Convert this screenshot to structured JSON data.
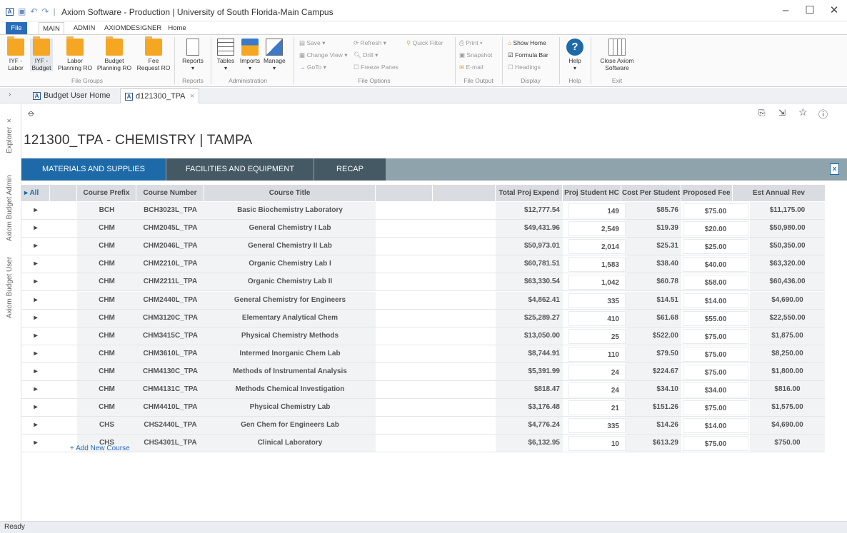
{
  "window": {
    "title": "Axiom Software - Production | University of South Florida-Main Campus",
    "minimize": "–",
    "maximize": "☐",
    "close": "✕"
  },
  "ribbon_tabs": [
    "File",
    "MAIN",
    "ADMIN",
    "AXIOMDESIGNER",
    "Home"
  ],
  "ribbon": {
    "file_groups": {
      "label": "File Groups",
      "buttons": [
        "IYF -\nLabor",
        "IYF -\nBudget",
        "Labor\nPlanning RO",
        "Budget\nPlanning RO",
        "Fee\nRequest RO"
      ]
    },
    "reports": {
      "label": "Reports",
      "button": "Reports"
    },
    "administration": {
      "label": "Administration",
      "buttons": [
        "Tables",
        "Imports",
        "Manage"
      ]
    },
    "file_options": {
      "label": "File Options",
      "save": "Save",
      "refresh": "Refresh",
      "quick_filter": "Quick Filter",
      "change_view": "Change View",
      "drill": "Drill",
      "goto": "GoTo",
      "freeze_panes": "Freeze Panes"
    },
    "file_output": {
      "label": "File Output",
      "print": "Print",
      "snapshot": "Snapshot",
      "email": "E-mail"
    },
    "display": {
      "label": "Display",
      "show_home": "Show Home",
      "formula_bar": "Formula Bar",
      "headings": "Headings"
    },
    "help": {
      "label": "Help",
      "button": "Help"
    },
    "exit": {
      "label": "Exit",
      "button": "Close Axiom\nSoftware"
    }
  },
  "doc_tabs": [
    {
      "label": "Budget User Home"
    },
    {
      "label": "d121300_TPA",
      "close": "×"
    }
  ],
  "side_tabs": [
    "Explorer",
    "Axiom Budget Admin",
    "Axiom Budget User"
  ],
  "page": {
    "title": "121300_TPA - CHEMISTRY | TAMPA"
  },
  "tabs": [
    "MATERIALS AND SUPPLIES",
    "FACILITIES AND EQUIPMENT",
    "RECAP"
  ],
  "table": {
    "all_label": "All",
    "headers": [
      "Course Prefix",
      "Course Number",
      "Course Title",
      "Total Proj Expend",
      "Proj Student HC",
      "Cost Per Student",
      "Proposed Fee",
      "Est Annual Rev"
    ],
    "rows": [
      {
        "prefix": "BCH",
        "number": "BCH3023L_TPA",
        "title": "Basic Biochemistry Laboratory",
        "expend": "$12,777.54",
        "hc": "149",
        "cps": "$85.76",
        "fee": "$75.00",
        "rev": "$11,175.00"
      },
      {
        "prefix": "CHM",
        "number": "CHM2045L_TPA",
        "title": "General Chemistry I Lab",
        "expend": "$49,431.96",
        "hc": "2,549",
        "cps": "$19.39",
        "fee": "$20.00",
        "rev": "$50,980.00"
      },
      {
        "prefix": "CHM",
        "number": "CHM2046L_TPA",
        "title": "General Chemistry II Lab",
        "expend": "$50,973.01",
        "hc": "2,014",
        "cps": "$25.31",
        "fee": "$25.00",
        "rev": "$50,350.00"
      },
      {
        "prefix": "CHM",
        "number": "CHM2210L_TPA",
        "title": "Organic Chemistry Lab I",
        "expend": "$60,781.51",
        "hc": "1,583",
        "cps": "$38.40",
        "fee": "$40.00",
        "rev": "$63,320.00"
      },
      {
        "prefix": "CHM",
        "number": "CHM2211L_TPA",
        "title": "Organic Chemistry Lab II",
        "expend": "$63,330.54",
        "hc": "1,042",
        "cps": "$60.78",
        "fee": "$58.00",
        "rev": "$60,436.00"
      },
      {
        "prefix": "CHM",
        "number": "CHM2440L_TPA",
        "title": "General Chemistry for Engineers",
        "expend": "$4,862.41",
        "hc": "335",
        "cps": "$14.51",
        "fee": "$14.00",
        "rev": "$4,690.00"
      },
      {
        "prefix": "CHM",
        "number": "CHM3120C_TPA",
        "title": "Elementary Analytical Chem",
        "expend": "$25,289.27",
        "hc": "410",
        "cps": "$61.68",
        "fee": "$55.00",
        "rev": "$22,550.00"
      },
      {
        "prefix": "CHM",
        "number": "CHM3415C_TPA",
        "title": "Physical Chemistry Methods",
        "expend": "$13,050.00",
        "hc": "25",
        "cps": "$522.00",
        "fee": "$75.00",
        "rev": "$1,875.00"
      },
      {
        "prefix": "CHM",
        "number": "CHM3610L_TPA",
        "title": "Intermed Inorganic Chem Lab",
        "expend": "$8,744.91",
        "hc": "110",
        "cps": "$79.50",
        "fee": "$75.00",
        "rev": "$8,250.00"
      },
      {
        "prefix": "CHM",
        "number": "CHM4130C_TPA",
        "title": "Methods of Instrumental Analysis",
        "expend": "$5,391.99",
        "hc": "24",
        "cps": "$224.67",
        "fee": "$75.00",
        "rev": "$1,800.00"
      },
      {
        "prefix": "CHM",
        "number": "CHM4131C_TPA",
        "title": "Methods Chemical Investigation",
        "expend": "$818.47",
        "hc": "24",
        "cps": "$34.10",
        "fee": "$34.00",
        "rev": "$816.00"
      },
      {
        "prefix": "CHM",
        "number": "CHM4410L_TPA",
        "title": "Physical Chemistry Lab",
        "expend": "$3,176.48",
        "hc": "21",
        "cps": "$151.26",
        "fee": "$75.00",
        "rev": "$1,575.00"
      },
      {
        "prefix": "CHS",
        "number": "CHS2440L_TPA",
        "title": "Gen Chem for Engineers Lab",
        "expend": "$4,776.24",
        "hc": "335",
        "cps": "$14.26",
        "fee": "$14.00",
        "rev": "$4,690.00"
      },
      {
        "prefix": "CHS",
        "number": "CHS4301L_TPA",
        "title": "Clinical Laboratory",
        "expend": "$6,132.95",
        "hc": "10",
        "cps": "$613.29",
        "fee": "$75.00",
        "rev": "$750.00"
      }
    ],
    "add_new": "+ Add New Course"
  },
  "status": "Ready",
  "colors": {
    "tab_active": "#1e6aa8",
    "tab_inactive": "#455964",
    "tab_bar": "#8fa3ad",
    "file_tab": "#2b6cb8"
  }
}
